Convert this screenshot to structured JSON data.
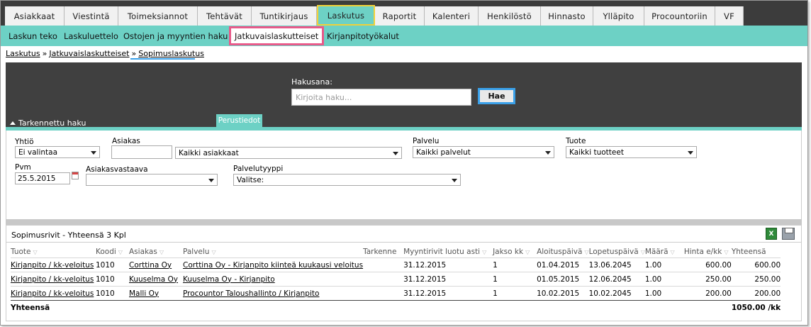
{
  "topnav": {
    "tabs": [
      "Asiakkaat",
      "Viestintä",
      "Toimeksiannot",
      "Tehtävät",
      "Tuntikirjaus",
      "Laskutus",
      "Raportit",
      "Kalenteri",
      "Henkilöstö",
      "Hinnasto",
      "Ylläpito",
      "Procountoriin",
      "VF"
    ],
    "active": "Laskutus"
  },
  "subnav": {
    "items": [
      "Laskun teko",
      "Laskuluettelo",
      "Ostojen ja myyntien haku",
      "Jatkuvaislaskutteiset",
      "Kirjanpitotyökalut"
    ],
    "active": "Jatkuvaislaskutteiset"
  },
  "breadcrumb": {
    "items": [
      "Laskutus",
      "Jatkuvaislaskutteiset",
      "Sopimuslaskutus"
    ],
    "separator": "»"
  },
  "search": {
    "label": "Hakusana:",
    "placeholder": "Kirjoita haku...",
    "button": "Hae",
    "advanced": "Tarkennettu haku",
    "tab": "Perustiedot"
  },
  "filters": {
    "yhtio": {
      "label": "Yhtiö",
      "value": "Ei valintaa"
    },
    "asiakas": {
      "label": "Asiakas",
      "input": "",
      "value": "Kaikki asiakkaat"
    },
    "palvelu": {
      "label": "Palvelu",
      "value": "Kaikki palvelut"
    },
    "tuote": {
      "label": "Tuote",
      "value": "Kaikki tuotteet"
    },
    "pvm": {
      "label": "Pvm",
      "value": "25.5.2015"
    },
    "asiakasvastaava": {
      "label": "Asiakasvastaava",
      "value": ""
    },
    "palvelutyyppi": {
      "label": "Palvelutyyppi",
      "value": "Valitse:"
    }
  },
  "table": {
    "title": "Sopimusrivit - Yhteensä 3 Kpl",
    "columns": [
      "Tuote",
      "Koodi",
      "Asiakas",
      "Palvelu",
      "Tarkenne",
      "Myyntirivit luotu asti",
      "Jakso kk",
      "Aloituspäivä",
      "Lopetuspäivä",
      "Määrä",
      "Hinta e/kk",
      "Yhteensä"
    ],
    "rows": [
      [
        "Kirjanpito / kk-veloitus",
        "1010",
        "Corttina Oy",
        "Corttina Oy - Kirjanpito kiinteä kuukausi veloitus",
        "",
        "31.12.2015",
        "1",
        "01.04.2015",
        "13.06.2045",
        "1.00",
        "600.00",
        "600.00"
      ],
      [
        "Kirjanpito / kk-veloitus",
        "1010",
        "Kuuselma Oy",
        "Kuuselma Oy - Kirjanpito",
        "",
        "31.12.2015",
        "1",
        "01.05.2015",
        "12.06.2045",
        "1.00",
        "250.00",
        "250.00"
      ],
      [
        "Kirjanpito / kk-veloitus",
        "1010",
        "Malli Oy",
        "Procountor Taloushallinto / Kirjanpito",
        "",
        "31.12.2015",
        "1",
        "10.02.2015",
        "10.02.2045",
        "1.00",
        "200.00",
        "200.00"
      ]
    ],
    "total_label": "Yhteensä",
    "total_value": "1050.00 /kk"
  },
  "icons": {
    "excel": "excel-export-icon",
    "print": "print-icon"
  }
}
